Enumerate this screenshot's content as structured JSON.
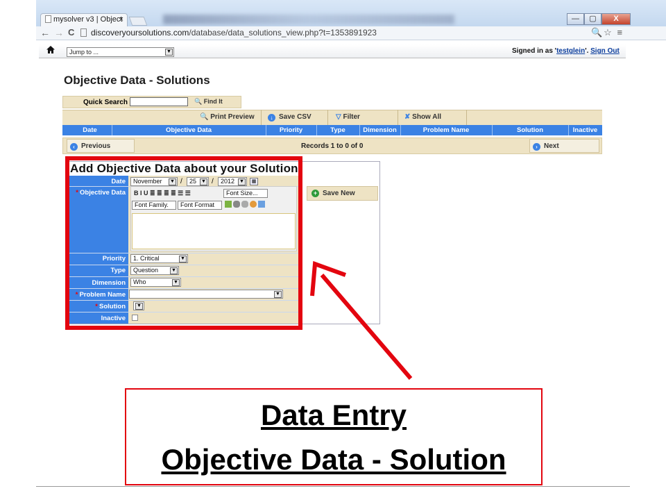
{
  "browser": {
    "tab_title": "mysolver v3 | Object",
    "tab_close": "×",
    "window_buttons": {
      "minimize": "—",
      "maximize": "▢",
      "close": "X"
    },
    "back": "←",
    "forward": "→",
    "reload": "C",
    "url_domain": "discoveryoursolutions.com",
    "url_path": "/database/data_solutions_view.php?t=1353891923",
    "url_icons": "🔍☆ ≡"
  },
  "sitebar": {
    "home_icon": "house-icon",
    "jump_value": "Jump to ...",
    "signed_in_prefix": "Signed in as '",
    "username": "testglein",
    "signed_in_suffix": "'. ",
    "sign_out": "Sign Out"
  },
  "page": {
    "title": "Objective Data - Solutions",
    "quick_search_label": "Quick Search",
    "find_it": "Find It",
    "toolbar": {
      "print_preview": "Print Preview",
      "save_csv": "Save CSV",
      "filter": "Filter",
      "show_all": "Show All"
    },
    "columns": [
      "Date",
      "Objective Data",
      "Priority",
      "Type",
      "Dimension",
      "Problem Name",
      "Solution",
      "Inactive"
    ],
    "previous": "Previous",
    "next": "Next",
    "records": "Records 1 to 0 of 0"
  },
  "form": {
    "title": "Add Objective Data about your Solution",
    "labels": {
      "date": "Date",
      "objective_data": "Objective Data",
      "priority": "Priority",
      "type": "Type",
      "dimension": "Dimension",
      "problem_name": "Problem Name",
      "solution": "Solution",
      "inactive": "Inactive"
    },
    "required_marker": "*",
    "date_month": "November",
    "date_day": "25",
    "date_year": "2012",
    "date_sep": "/",
    "editor_row1": "B  I  U  ≣ ≣ ≣ ≣  ☰ ☰",
    "font_size": "Font Size...",
    "font_family": "Font Family.",
    "font_format": "Font Format",
    "priority_value": "1. Critical",
    "type_value": "Question",
    "dimension_value": "Who",
    "problem_name_value": "",
    "solution_value": "",
    "save_new": "Save New"
  },
  "caption": {
    "line1": "Data Entry",
    "line2": "Objective Data - Solution"
  },
  "colors": {
    "accent_blue": "#3b82e4",
    "panel_tan": "#eee3c4",
    "highlight_red": "#e3050f"
  }
}
